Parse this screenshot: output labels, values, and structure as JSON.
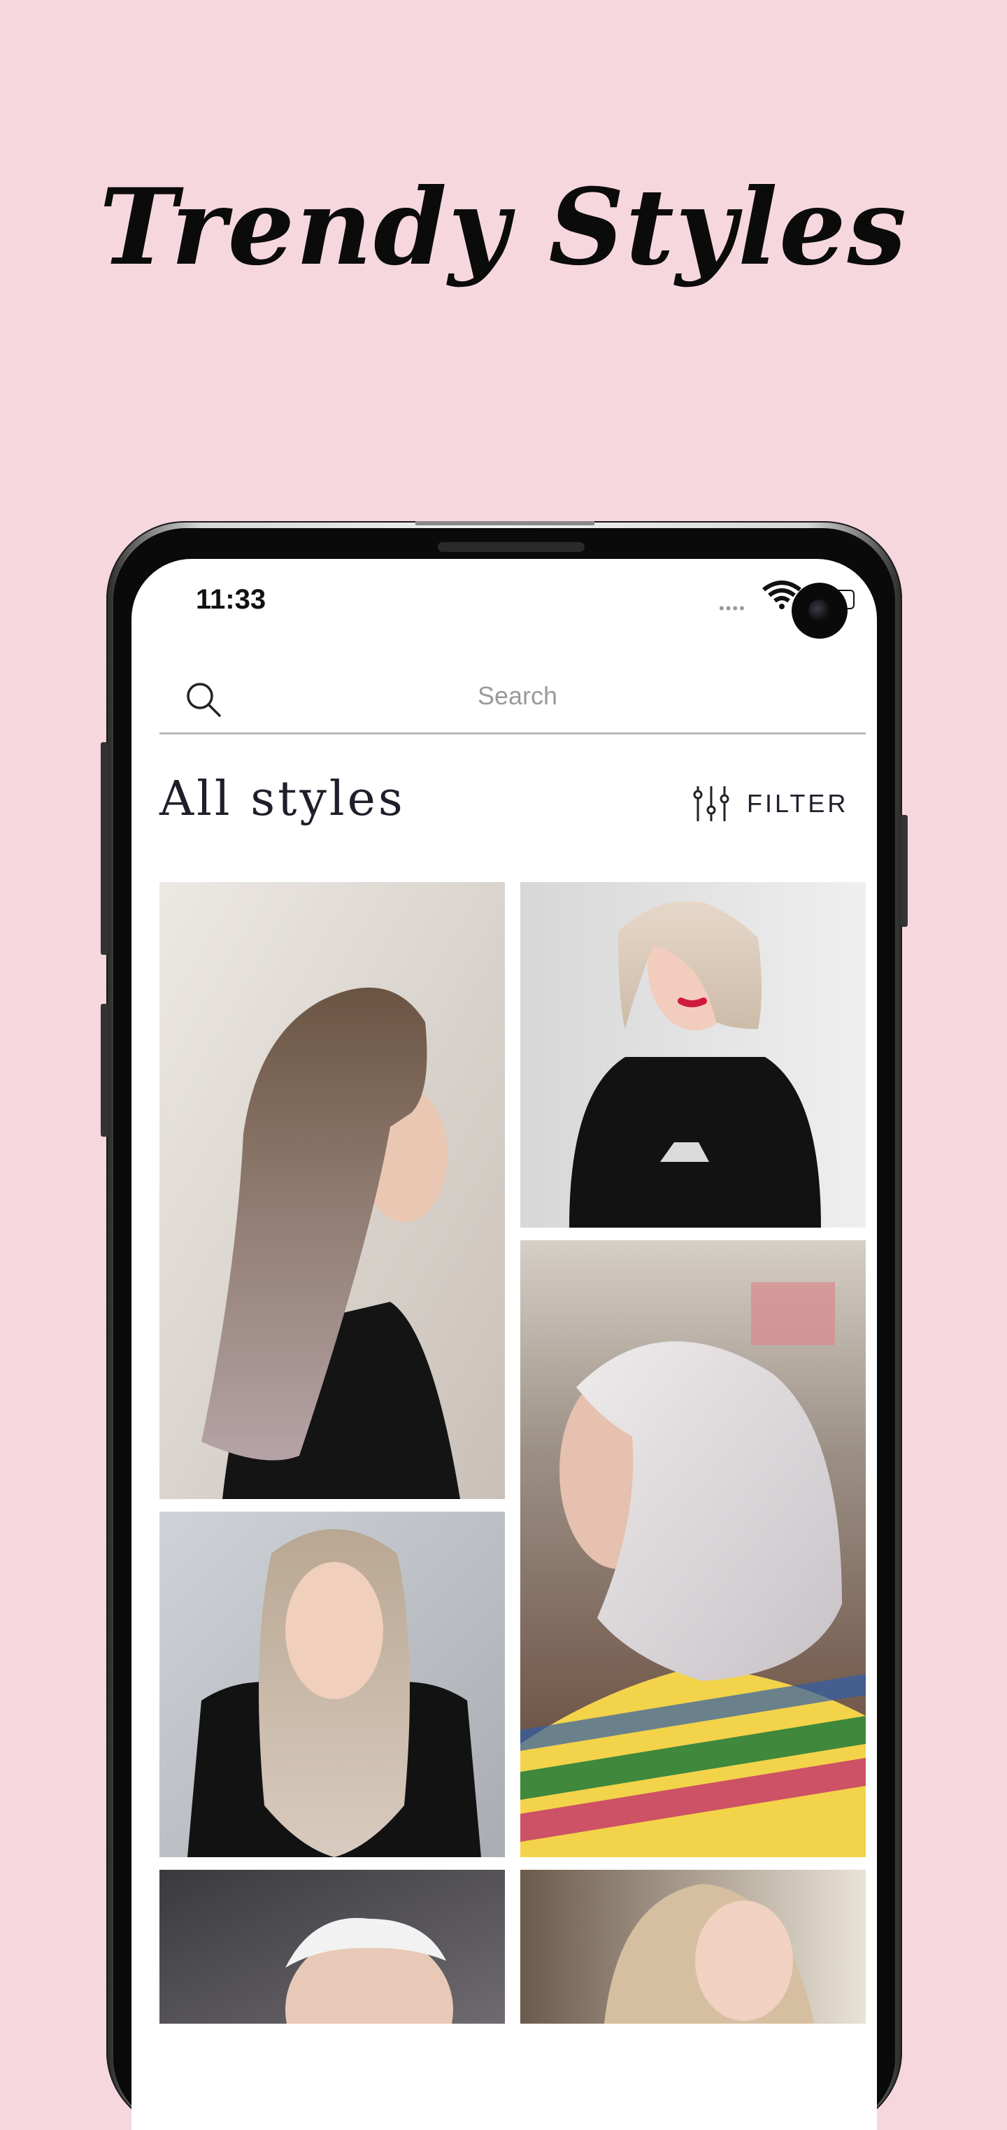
{
  "headline": "Trendy Styles",
  "status_bar": {
    "time": "11:33",
    "signal": "••••"
  },
  "search": {
    "placeholder": "Search"
  },
  "section": {
    "title": "All styles",
    "filter_label": "FILTER"
  },
  "gallery": {
    "items": [
      {
        "id": "long-ash-brown-straight"
      },
      {
        "id": "platinum-bob-red-lips"
      },
      {
        "id": "silver-blunt-bob"
      },
      {
        "id": "long-blonde-straight"
      },
      {
        "id": "platinum-crop"
      },
      {
        "id": "blonde-layered"
      }
    ]
  },
  "colors": {
    "background": "#f7d7de",
    "text_dark": "#1f1f2b",
    "divider": "#b9b9b9"
  }
}
